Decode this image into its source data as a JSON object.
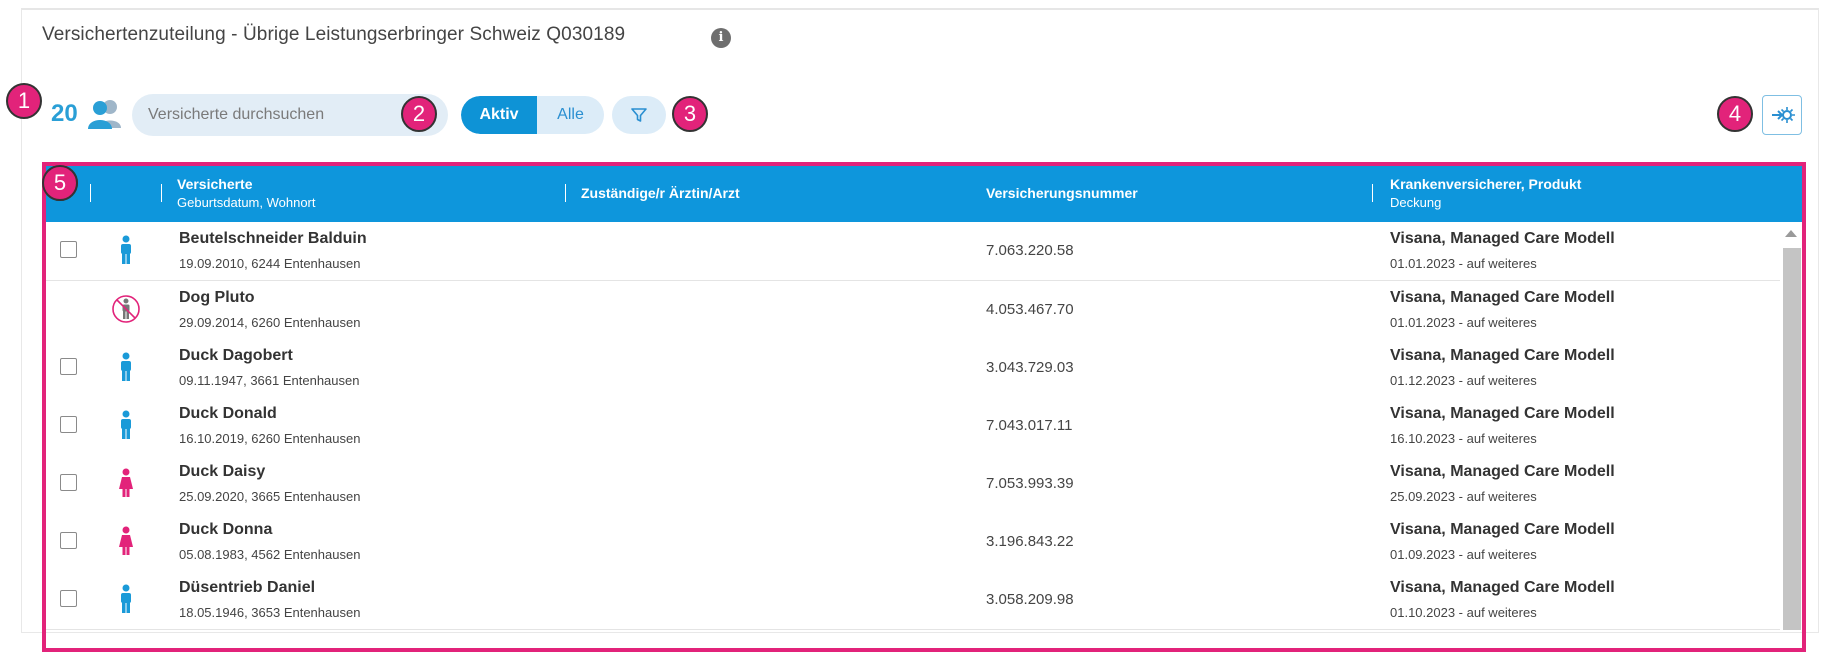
{
  "page": {
    "title": "Versichertenzuteilung - Übrige Leistungserbringer Schweiz Q030189",
    "info_icon": "info-icon"
  },
  "toolbar": {
    "count": "20",
    "people_icon": "people-icon",
    "search_placeholder": "Versicherte durchsuchen",
    "toggle_active": "Aktiv",
    "toggle_all": "Alle",
    "filter_icon": "filter-icon",
    "export_icon": "logout-icon"
  },
  "callouts": [
    "1",
    "2",
    "3",
    "4",
    "5"
  ],
  "table": {
    "headers": {
      "insured": "Versicherte",
      "insured_sub": "Geburtsdatum, Wohnort",
      "doctor": "Zuständige/r Ärztin/Arzt",
      "number": "Versicherungsnummer",
      "insurer": "Krankenversicherer, Produkt",
      "insurer_sub": "Deckung"
    },
    "rows": [
      {
        "name": "Beutelschneider Balduin",
        "dob": "19.09.2010, 6244 Entenhausen",
        "vnr": "7.063.220.58",
        "insurer": "Visana, Managed Care Modell",
        "coverage": "01.01.2023 - auf weiteres",
        "gender": "male",
        "checkbox": true
      },
      {
        "name": "Dog Pluto",
        "dob": "29.09.2014, 6260 Entenhausen",
        "vnr": "4.053.467.70",
        "insurer": "Visana, Managed Care Modell",
        "coverage": "01.01.2023 - auf weiteres",
        "gender": "excluded",
        "checkbox": false
      },
      {
        "name": "Duck Dagobert",
        "dob": "09.11.1947, 3661 Entenhausen",
        "vnr": "3.043.729.03",
        "insurer": "Visana, Managed Care Modell",
        "coverage": "01.12.2023 - auf weiteres",
        "gender": "male",
        "checkbox": true
      },
      {
        "name": "Duck Donald",
        "dob": "16.10.2019, 6260 Entenhausen",
        "vnr": "7.043.017.11",
        "insurer": "Visana, Managed Care Modell",
        "coverage": "16.10.2023 - auf weiteres",
        "gender": "male",
        "checkbox": true
      },
      {
        "name": "Duck Daisy",
        "dob": "25.09.2020, 3665 Entenhausen",
        "vnr": "7.053.993.39",
        "insurer": "Visana, Managed Care Modell",
        "coverage": "25.09.2023 - auf weiteres",
        "gender": "female",
        "checkbox": true
      },
      {
        "name": "Duck Donna",
        "dob": "05.08.1983, 4562 Entenhausen",
        "vnr": "3.196.843.22",
        "insurer": "Visana, Managed Care Modell",
        "coverage": "01.09.2023 - auf weiteres",
        "gender": "female",
        "checkbox": true
      },
      {
        "name": "Düsentrieb Daniel",
        "dob": "18.05.1946, 3653 Entenhausen",
        "vnr": "3.058.209.98",
        "insurer": "Visana, Managed Care Modell",
        "coverage": "01.10.2023 - auf weiteres",
        "gender": "male",
        "checkbox": true
      }
    ]
  },
  "colors": {
    "accent": "#0e96dc",
    "callout": "#e2237a",
    "male": "#1a9ad8",
    "female": "#e2237a"
  }
}
